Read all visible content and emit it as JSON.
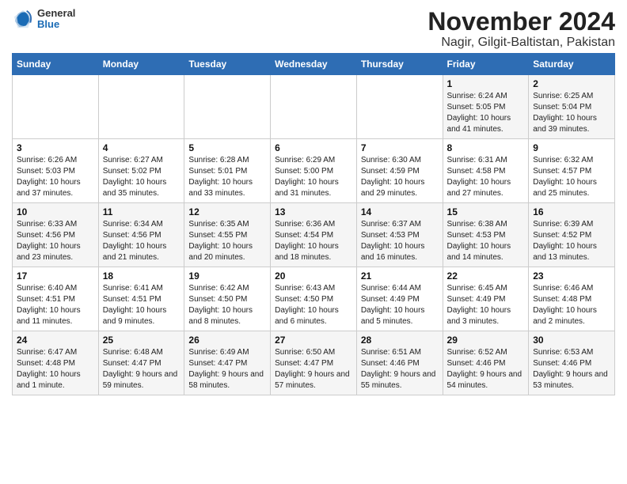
{
  "logo": {
    "general": "General",
    "blue": "Blue"
  },
  "header": {
    "title": "November 2024",
    "subtitle": "Nagir, Gilgit-Baltistan, Pakistan"
  },
  "weekdays": [
    "Sunday",
    "Monday",
    "Tuesday",
    "Wednesday",
    "Thursday",
    "Friday",
    "Saturday"
  ],
  "weeks": [
    [
      {
        "day": "",
        "info": ""
      },
      {
        "day": "",
        "info": ""
      },
      {
        "day": "",
        "info": ""
      },
      {
        "day": "",
        "info": ""
      },
      {
        "day": "",
        "info": ""
      },
      {
        "day": "1",
        "info": "Sunrise: 6:24 AM\nSunset: 5:05 PM\nDaylight: 10 hours and 41 minutes."
      },
      {
        "day": "2",
        "info": "Sunrise: 6:25 AM\nSunset: 5:04 PM\nDaylight: 10 hours and 39 minutes."
      }
    ],
    [
      {
        "day": "3",
        "info": "Sunrise: 6:26 AM\nSunset: 5:03 PM\nDaylight: 10 hours and 37 minutes."
      },
      {
        "day": "4",
        "info": "Sunrise: 6:27 AM\nSunset: 5:02 PM\nDaylight: 10 hours and 35 minutes."
      },
      {
        "day": "5",
        "info": "Sunrise: 6:28 AM\nSunset: 5:01 PM\nDaylight: 10 hours and 33 minutes."
      },
      {
        "day": "6",
        "info": "Sunrise: 6:29 AM\nSunset: 5:00 PM\nDaylight: 10 hours and 31 minutes."
      },
      {
        "day": "7",
        "info": "Sunrise: 6:30 AM\nSunset: 4:59 PM\nDaylight: 10 hours and 29 minutes."
      },
      {
        "day": "8",
        "info": "Sunrise: 6:31 AM\nSunset: 4:58 PM\nDaylight: 10 hours and 27 minutes."
      },
      {
        "day": "9",
        "info": "Sunrise: 6:32 AM\nSunset: 4:57 PM\nDaylight: 10 hours and 25 minutes."
      }
    ],
    [
      {
        "day": "10",
        "info": "Sunrise: 6:33 AM\nSunset: 4:56 PM\nDaylight: 10 hours and 23 minutes."
      },
      {
        "day": "11",
        "info": "Sunrise: 6:34 AM\nSunset: 4:56 PM\nDaylight: 10 hours and 21 minutes."
      },
      {
        "day": "12",
        "info": "Sunrise: 6:35 AM\nSunset: 4:55 PM\nDaylight: 10 hours and 20 minutes."
      },
      {
        "day": "13",
        "info": "Sunrise: 6:36 AM\nSunset: 4:54 PM\nDaylight: 10 hours and 18 minutes."
      },
      {
        "day": "14",
        "info": "Sunrise: 6:37 AM\nSunset: 4:53 PM\nDaylight: 10 hours and 16 minutes."
      },
      {
        "day": "15",
        "info": "Sunrise: 6:38 AM\nSunset: 4:53 PM\nDaylight: 10 hours and 14 minutes."
      },
      {
        "day": "16",
        "info": "Sunrise: 6:39 AM\nSunset: 4:52 PM\nDaylight: 10 hours and 13 minutes."
      }
    ],
    [
      {
        "day": "17",
        "info": "Sunrise: 6:40 AM\nSunset: 4:51 PM\nDaylight: 10 hours and 11 minutes."
      },
      {
        "day": "18",
        "info": "Sunrise: 6:41 AM\nSunset: 4:51 PM\nDaylight: 10 hours and 9 minutes."
      },
      {
        "day": "19",
        "info": "Sunrise: 6:42 AM\nSunset: 4:50 PM\nDaylight: 10 hours and 8 minutes."
      },
      {
        "day": "20",
        "info": "Sunrise: 6:43 AM\nSunset: 4:50 PM\nDaylight: 10 hours and 6 minutes."
      },
      {
        "day": "21",
        "info": "Sunrise: 6:44 AM\nSunset: 4:49 PM\nDaylight: 10 hours and 5 minutes."
      },
      {
        "day": "22",
        "info": "Sunrise: 6:45 AM\nSunset: 4:49 PM\nDaylight: 10 hours and 3 minutes."
      },
      {
        "day": "23",
        "info": "Sunrise: 6:46 AM\nSunset: 4:48 PM\nDaylight: 10 hours and 2 minutes."
      }
    ],
    [
      {
        "day": "24",
        "info": "Sunrise: 6:47 AM\nSunset: 4:48 PM\nDaylight: 10 hours and 1 minute."
      },
      {
        "day": "25",
        "info": "Sunrise: 6:48 AM\nSunset: 4:47 PM\nDaylight: 9 hours and 59 minutes."
      },
      {
        "day": "26",
        "info": "Sunrise: 6:49 AM\nSunset: 4:47 PM\nDaylight: 9 hours and 58 minutes."
      },
      {
        "day": "27",
        "info": "Sunrise: 6:50 AM\nSunset: 4:47 PM\nDaylight: 9 hours and 57 minutes."
      },
      {
        "day": "28",
        "info": "Sunrise: 6:51 AM\nSunset: 4:46 PM\nDaylight: 9 hours and 55 minutes."
      },
      {
        "day": "29",
        "info": "Sunrise: 6:52 AM\nSunset: 4:46 PM\nDaylight: 9 hours and 54 minutes."
      },
      {
        "day": "30",
        "info": "Sunrise: 6:53 AM\nSunset: 4:46 PM\nDaylight: 9 hours and 53 minutes."
      }
    ]
  ]
}
